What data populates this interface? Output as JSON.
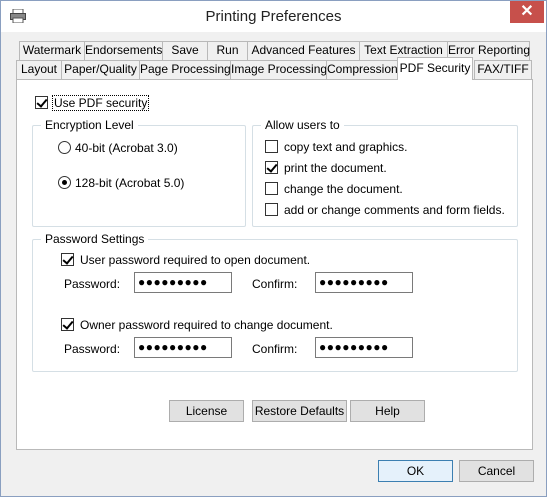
{
  "window": {
    "title": "Printing Preferences",
    "close_glyph": "✕",
    "icon": "printer-icon"
  },
  "tabs_row1": [
    "Watermark",
    "Endorsements",
    "Save",
    "Run",
    "Advanced Features",
    "Text Extraction",
    "Error Reporting"
  ],
  "tabs_row2": [
    "Layout",
    "Paper/Quality",
    "Page Processing",
    "Image Processing",
    "Compression",
    "PDF Security",
    "FAX/TIFF"
  ],
  "active_tab": "PDF Security",
  "use_pdf_security": {
    "label": "Use PDF security",
    "checked": true
  },
  "encryption": {
    "title": "Encryption Level",
    "options": [
      {
        "label": "40-bit (Acrobat 3.0)",
        "selected": false
      },
      {
        "label": "128-bit (Acrobat 5.0)",
        "selected": true
      }
    ]
  },
  "allow_users": {
    "title": "Allow users to",
    "options": [
      {
        "label": "copy text and graphics.",
        "checked": false
      },
      {
        "label": "print the document.",
        "checked": true
      },
      {
        "label": "change the document.",
        "checked": false
      },
      {
        "label": "add or change comments and form fields.",
        "checked": false
      }
    ]
  },
  "password_settings": {
    "title": "Password Settings",
    "user": {
      "label": "User password required to open document.",
      "checked": true,
      "password_label": "Password:",
      "password_value": "●●●●●●●●●",
      "confirm_label": "Confirm:",
      "confirm_value": "●●●●●●●●●"
    },
    "owner": {
      "label": "Owner password required to change document.",
      "checked": true,
      "password_label": "Password:",
      "password_value": "●●●●●●●●●",
      "confirm_label": "Confirm:",
      "confirm_value": "●●●●●●●●●"
    }
  },
  "buttons": {
    "license": "License",
    "restore": "Restore Defaults",
    "help": "Help",
    "ok": "OK",
    "cancel": "Cancel"
  }
}
